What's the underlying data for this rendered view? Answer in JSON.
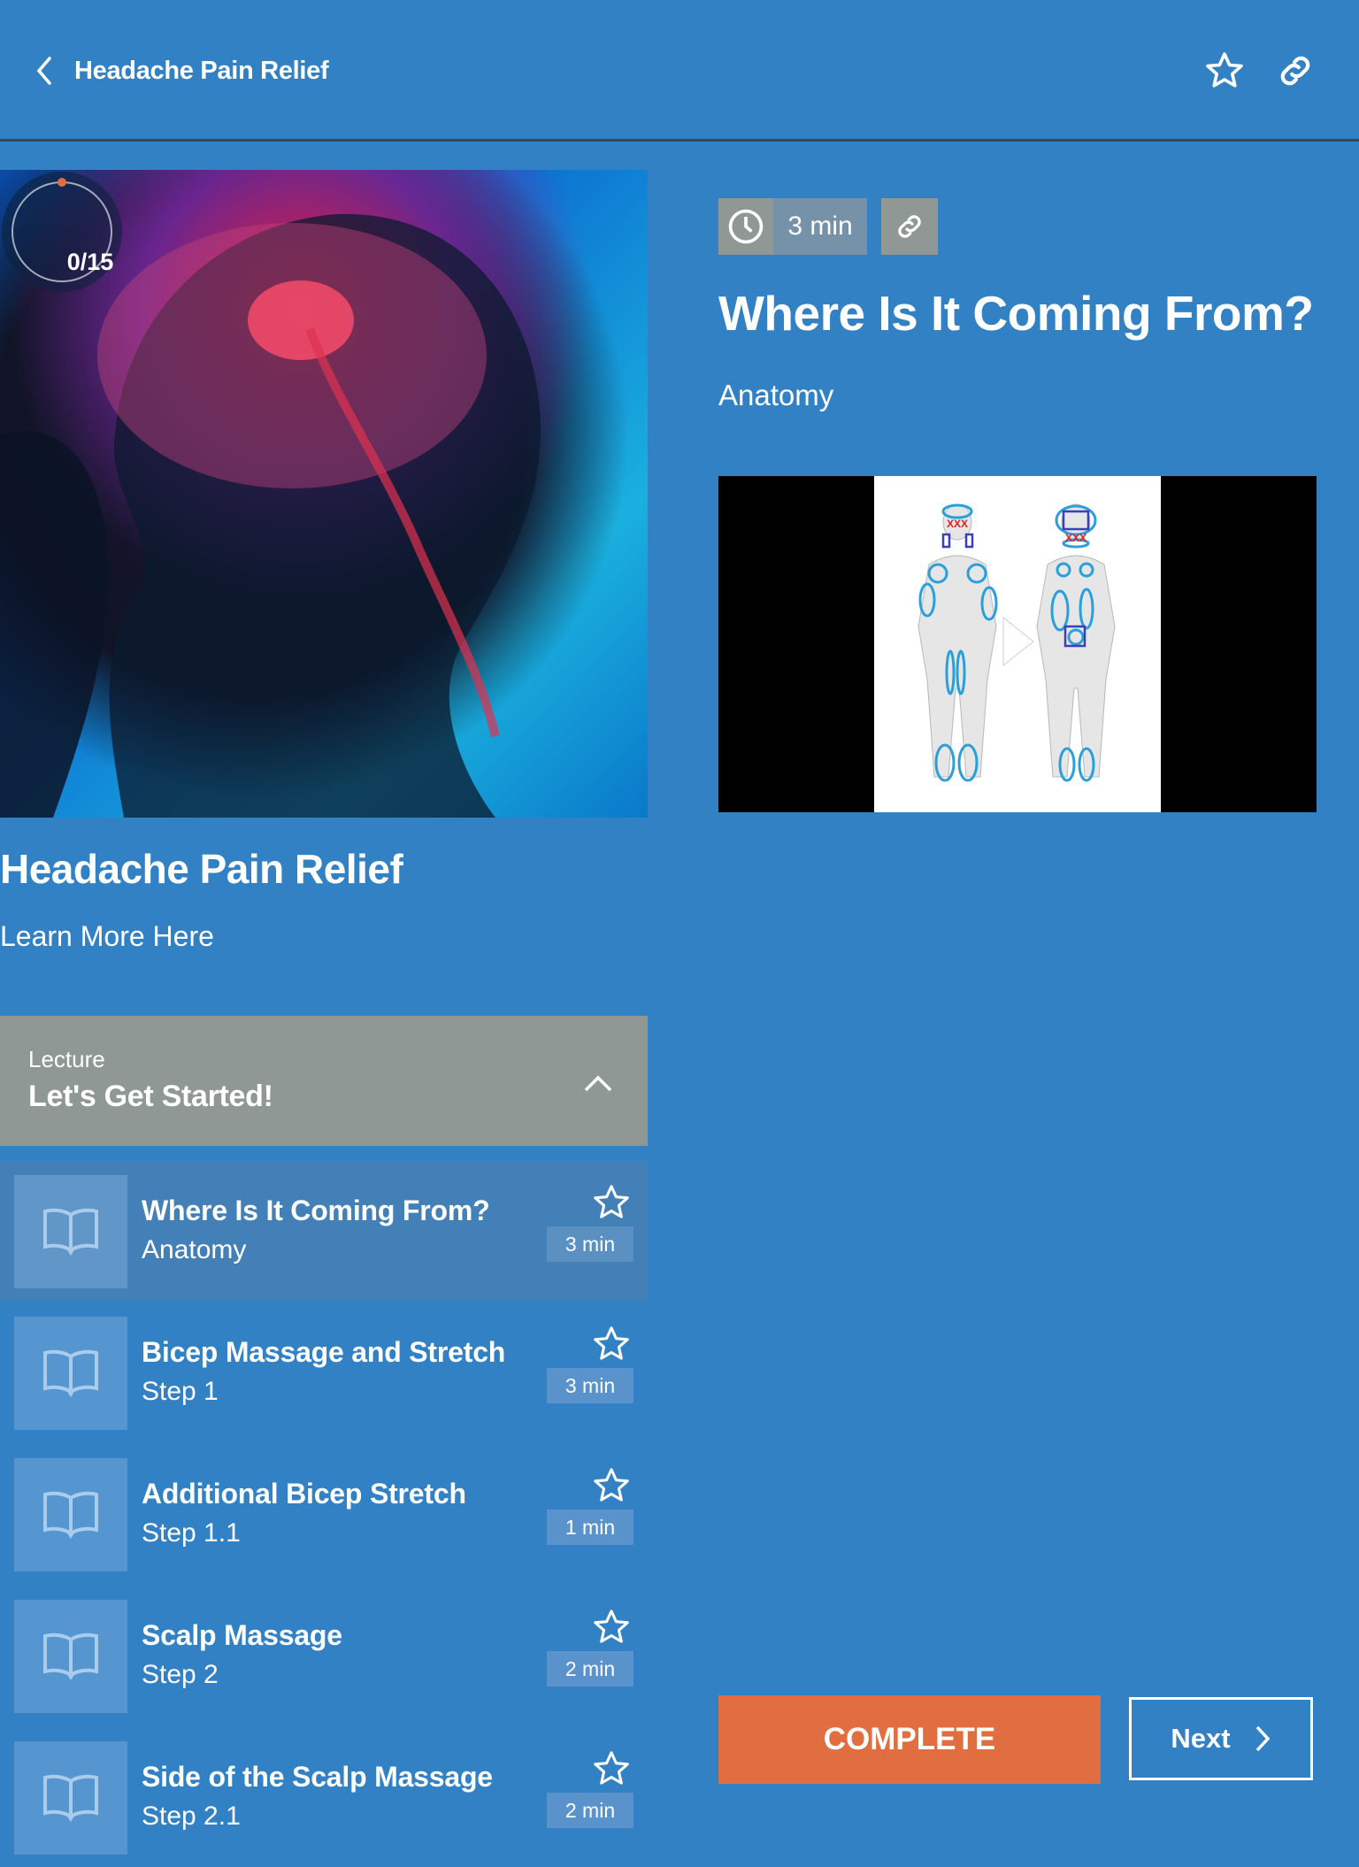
{
  "header": {
    "back_title": "Headache Pain Relief",
    "icons": [
      "chevron-left-icon",
      "star-icon",
      "link-icon"
    ]
  },
  "course": {
    "progress_text": "0/15",
    "progress_fraction": 0,
    "title": "Headache Pain Relief",
    "learn_more": "Learn More Here",
    "image": "brain-headache-illustration"
  },
  "section": {
    "type": "Lecture",
    "name": "Let's Get Started!",
    "expanded": true
  },
  "lessons": [
    {
      "title": "Where Is It Coming From?",
      "subtitle": "Anatomy",
      "duration": "3 min",
      "active": true
    },
    {
      "title": "Bicep Massage and Stretch",
      "subtitle": "Step 1",
      "duration": "3 min",
      "active": false
    },
    {
      "title": "Additional Bicep Stretch",
      "subtitle": "Step 1.1",
      "duration": "1 min",
      "active": false
    },
    {
      "title": "Scalp Massage",
      "subtitle": "Step 2",
      "duration": "2 min",
      "active": false
    },
    {
      "title": "Side of the Scalp Massage",
      "subtitle": "Step 2.1",
      "duration": "2 min",
      "active": false
    }
  ],
  "detail": {
    "duration": "3 min",
    "title": "Where Is It Coming From?",
    "subtitle": "Anatomy",
    "video": "body-anatomy-trigger-points-video"
  },
  "actions": {
    "complete": "COMPLETE",
    "next": "Next"
  },
  "colors": {
    "background": "#3281c4",
    "accent": "#e06e41",
    "section_header": "#8f9895",
    "progress_dot": "#e06e41"
  }
}
